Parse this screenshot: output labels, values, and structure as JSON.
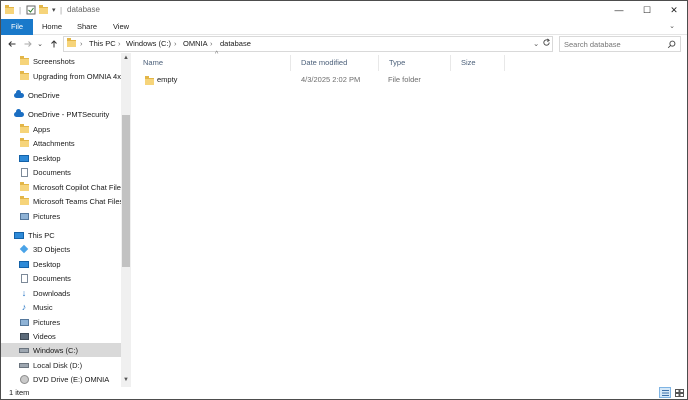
{
  "window": {
    "title": "database",
    "controls": {
      "minimize": "—",
      "maximize": "☐",
      "close": "✕"
    }
  },
  "ribbon": {
    "tabs": [
      "File",
      "Home",
      "Share",
      "View"
    ]
  },
  "address": {
    "crumbs": [
      "This PC",
      "Windows (C:)",
      "OMNIA",
      "database"
    ],
    "separator": "›",
    "search_placeholder": "Search database"
  },
  "nav": {
    "items": [
      {
        "label": "Screenshots",
        "icon": "folder-icon"
      },
      {
        "label": "Upgrading from OMNIA 4x",
        "icon": "folder-icon"
      },
      {
        "label": "OneDrive",
        "icon": "onedrive-icon"
      },
      {
        "label": "OneDrive - PMTSecurity",
        "icon": "onedrive-icon"
      },
      {
        "label": "Apps",
        "icon": "folder-icon"
      },
      {
        "label": "Attachments",
        "icon": "folder-icon"
      },
      {
        "label": "Desktop",
        "icon": "desktop-icon"
      },
      {
        "label": "Documents",
        "icon": "documents-icon"
      },
      {
        "label": "Microsoft Copilot Chat Files",
        "icon": "folder-icon"
      },
      {
        "label": "Microsoft Teams Chat Files",
        "icon": "folder-icon"
      },
      {
        "label": "Pictures",
        "icon": "pictures-icon"
      },
      {
        "label": "This PC",
        "icon": "this-pc-icon"
      },
      {
        "label": "3D Objects",
        "icon": "3d-objects-icon"
      },
      {
        "label": "Desktop",
        "icon": "desktop-icon"
      },
      {
        "label": "Documents",
        "icon": "documents-icon"
      },
      {
        "label": "Downloads",
        "icon": "downloads-icon"
      },
      {
        "label": "Music",
        "icon": "music-icon"
      },
      {
        "label": "Pictures",
        "icon": "pictures-icon"
      },
      {
        "label": "Videos",
        "icon": "videos-icon"
      },
      {
        "label": "Windows (C:)",
        "icon": "drive-icon",
        "selected": true
      },
      {
        "label": "Local Disk (D:)",
        "icon": "drive-icon"
      },
      {
        "label": "DVD Drive (E:) OMNIA",
        "icon": "dvd-icon"
      }
    ]
  },
  "columns": [
    "Name",
    "Date modified",
    "Type",
    "Size"
  ],
  "files": [
    {
      "name": "empty",
      "date": "4/3/2025 2:02 PM",
      "type": "File folder",
      "size": ""
    }
  ],
  "status": {
    "text": "1 item"
  },
  "colors": {
    "accent": "#1979ca",
    "folder": "#f6d47a",
    "selection": "#d9d9d9"
  }
}
